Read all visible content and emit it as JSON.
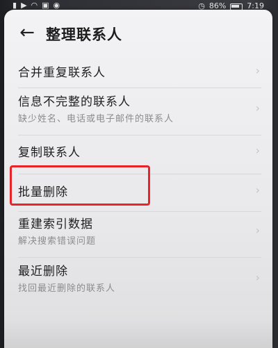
{
  "status_bar": {
    "left_icons": [
      "sim-icon",
      "video-icon",
      "wifi-icon",
      "image-icon",
      "chat-icon"
    ],
    "battery_percent": "86%",
    "time": "7:19"
  },
  "header": {
    "back_icon": "arrow-left-icon",
    "title": "整理联系人"
  },
  "menu": {
    "items": [
      {
        "title": "合并重复联系人",
        "subtitle": ""
      },
      {
        "title": "信息不完整的联系人",
        "subtitle": "缺少姓名、电话或电子邮件的联系人"
      },
      {
        "title": "复制联系人",
        "subtitle": ""
      },
      {
        "title": "批量删除",
        "subtitle": ""
      },
      {
        "title": "重建索引数据",
        "subtitle": "解决搜索错误问题"
      },
      {
        "title": "最近删除",
        "subtitle": "找回最近删除的联系人"
      }
    ],
    "chevron_icon": "chevron-right-icon",
    "highlighted_item": "批量删除"
  },
  "colors": {
    "highlight_border": "#e8242a",
    "panel_bg": "#f0f0f2",
    "title_text": "#1c1c1c",
    "sub_text": "#8c8c8c"
  }
}
